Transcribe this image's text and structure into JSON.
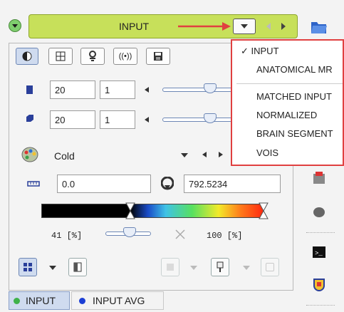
{
  "header": {
    "input_label": "INPUT"
  },
  "tabs": [
    {
      "name": "contrast-tab",
      "active": true
    },
    {
      "name": "grid-tab",
      "active": false
    },
    {
      "name": "gear-tab",
      "active": false
    },
    {
      "name": "signal-tab",
      "active": false
    },
    {
      "name": "save-tab",
      "active": false
    }
  ],
  "row1": {
    "value_a": "20",
    "value_b": "1"
  },
  "row2": {
    "value_a": "20",
    "value_b": "1"
  },
  "colormap": {
    "name": "Cold"
  },
  "range": {
    "min": "0.0",
    "max": "792.5234"
  },
  "percent": {
    "low": "41 [%]",
    "high": "100 [%]"
  },
  "bottom_tabs": [
    {
      "label": "INPUT",
      "color": "#3fb24a"
    },
    {
      "label": "INPUT AVG",
      "color": "#1c3fd4"
    }
  ],
  "dropdown": {
    "items": [
      {
        "label": "✓ INPUT",
        "checked": true
      },
      {
        "label": "ANATOMICAL MR"
      },
      {
        "label": "MATCHED INPUT"
      },
      {
        "label": "NORMALIZED"
      },
      {
        "label": "BRAIN SEGMENT"
      },
      {
        "label": "VOIS"
      }
    ]
  },
  "colors": {
    "accent_red": "#e04040",
    "input_bar": "#c7e05a",
    "active_tab": "#cfdbef"
  }
}
